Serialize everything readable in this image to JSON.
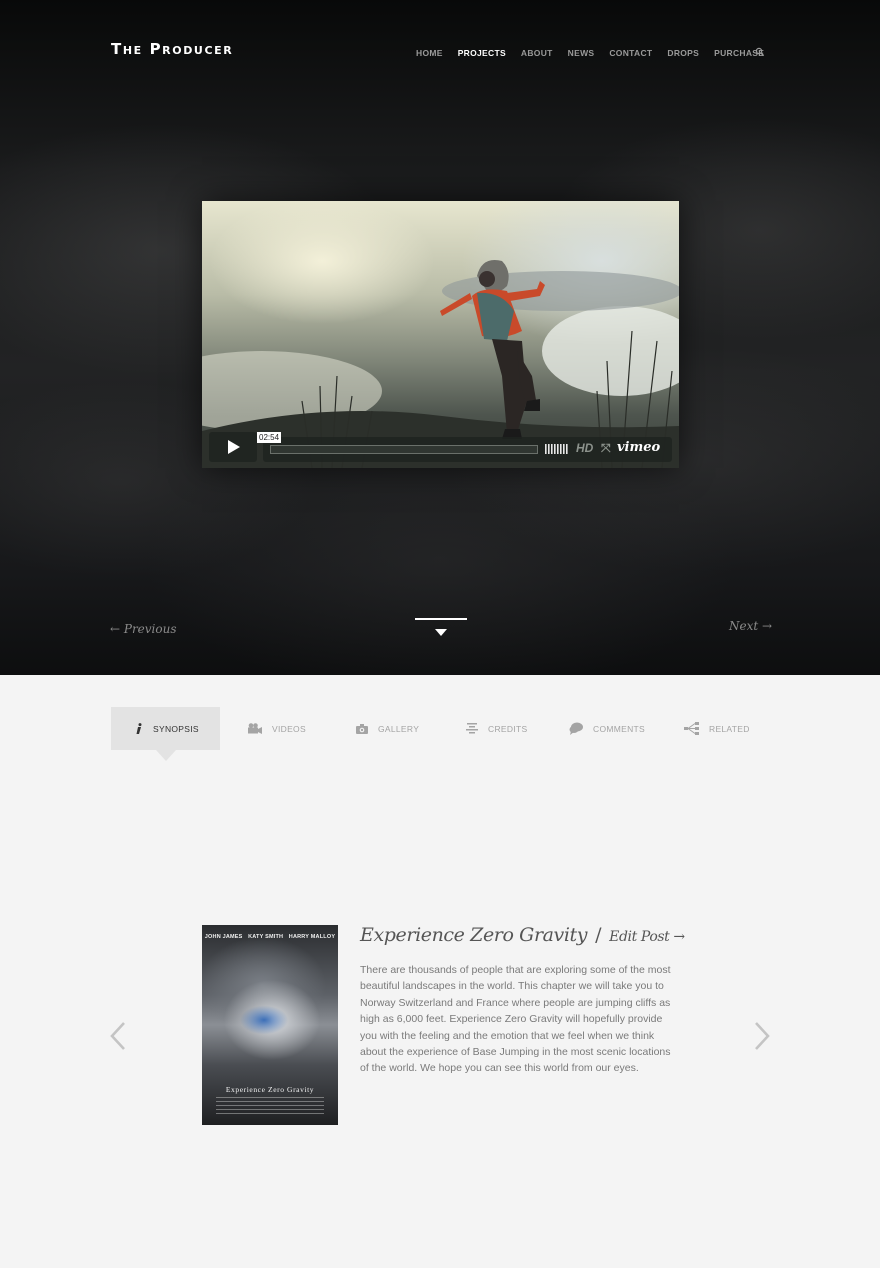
{
  "header": {
    "logo": "The Producer",
    "nav": [
      {
        "label": "HOME",
        "active": false
      },
      {
        "label": "PROJECTS",
        "active": true
      },
      {
        "label": "ABOUT",
        "active": false
      },
      {
        "label": "NEWS",
        "active": false
      },
      {
        "label": "CONTACT",
        "active": false
      },
      {
        "label": "DROPS",
        "active": false
      },
      {
        "label": "PURCHASE",
        "active": false
      }
    ],
    "search_icon": "search-icon"
  },
  "video": {
    "time": "02:54",
    "hd_label": "HD",
    "brand": "vimeo",
    "play_icon": "play-icon"
  },
  "pager": {
    "previous": "← Previous",
    "next": "Next →"
  },
  "tabs": [
    {
      "label": "SYNOPSIS",
      "icon": "info-icon",
      "active": true
    },
    {
      "label": "VIDEOS",
      "icon": "video-camera-icon",
      "active": false
    },
    {
      "label": "GALLERY",
      "icon": "camera-icon",
      "active": false
    },
    {
      "label": "CREDITS",
      "icon": "list-icon",
      "active": false
    },
    {
      "label": "COMMENTS",
      "icon": "speech-bubble-icon",
      "active": false
    },
    {
      "label": "RELATED",
      "icon": "share-icon",
      "active": false
    }
  ],
  "post": {
    "title": "Experience Zero Gravity",
    "separator": "/",
    "edit_link": "Edit Post →",
    "body": "There are thousands of people that are exploring some of the most beautiful landscapes in the world. This chapter we will take you to Norway Switzerland and France where people are jumping cliffs as high as 6,000 feet. Experience Zero Gravity will hopefully provide you with the feeling and the emotion that we feel when we think about the experience of Base Jumping in the most scenic locations of the world. We hope you can see this world from our eyes."
  },
  "poster": {
    "names": [
      "JOHN JAMES",
      "KATY SMITH",
      "HARRY MALLOY"
    ],
    "title": "Experience Zero Gravity"
  },
  "colors": {
    "accent": "#ffffff",
    "hero_bg": "#1a1b1c",
    "page_bg": "#f4f4f4",
    "active_tab_bg": "#e3e3e3"
  }
}
